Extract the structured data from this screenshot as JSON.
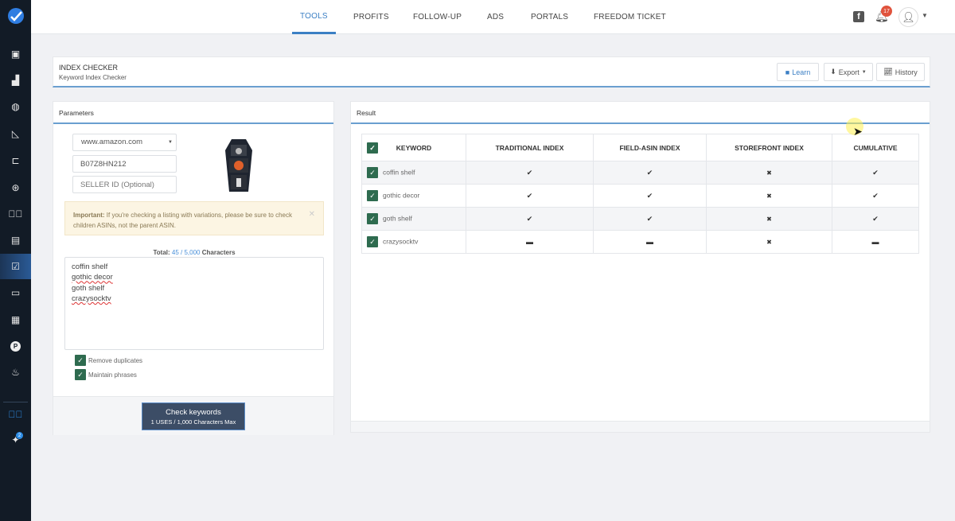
{
  "nav": {
    "tabs": [
      {
        "label": "TOOLS",
        "active": true
      },
      {
        "label": "PROFITS"
      },
      {
        "label": "FOLLOW-UP"
      },
      {
        "label": "ADS"
      },
      {
        "label": "PORTALS"
      },
      {
        "label": "FREEDOM TICKET"
      }
    ],
    "notification_count": "17"
  },
  "sidebar": {
    "icons": [
      "logo",
      "product-research-icon",
      "analytics-icon",
      "globe-icon",
      "chart-icon",
      "keyword-icon",
      "reel-icon",
      "check-circle-icon",
      "document-icon",
      "index-checker-icon",
      "store-icon",
      "warehouse-icon",
      "p-icon",
      "genie-lamp-icon",
      "play-icon",
      "pin-icon"
    ],
    "pin_badge": "2",
    "accent": "#2a5a96"
  },
  "header": {
    "title": "INDEX CHECKER",
    "subtitle": "Keyword Index Checker",
    "learn": "Learn",
    "export": "Export",
    "history": "History"
  },
  "params": {
    "title": "Parameters",
    "marketplace": "www.amazon.com",
    "asin": "B07Z8HN212",
    "seller_placeholder": "SELLER ID (Optional)",
    "alert_bold": "Important:",
    "alert_text": " If you're checking a listing with variations, please be sure to check children ASINs, not the parent ASIN.",
    "total_label": "Total:",
    "total_value": "45 / 5,000",
    "total_suffix": "Characters",
    "keywords": [
      "coffin shelf",
      "gothic decor",
      "goth shelf",
      "crazysocktv"
    ],
    "remove_duplicates": "Remove duplicates",
    "maintain_phrases": "Maintain phrases",
    "check_button": "Check keywords",
    "check_sub": "1 USES / 1,000 Characters Max"
  },
  "result": {
    "title": "Result",
    "columns": [
      "KEYWORD",
      "TRADITIONAL INDEX",
      "FIELD-ASIN INDEX",
      "STOREFRONT INDEX",
      "CUMULATIVE"
    ],
    "rows": [
      {
        "keyword": "coffin shelf",
        "traditional": "✔",
        "field": "✔",
        "storefront": "✖",
        "cumulative": "✔"
      },
      {
        "keyword": "gothic decor",
        "traditional": "✔",
        "field": "✔",
        "storefront": "✖",
        "cumulative": "✔"
      },
      {
        "keyword": "goth shelf",
        "traditional": "✔",
        "field": "✔",
        "storefront": "✖",
        "cumulative": "✔"
      },
      {
        "keyword": "crazysocktv",
        "traditional": "▬",
        "field": "▬",
        "storefront": "✖",
        "cumulative": "▬"
      }
    ]
  }
}
